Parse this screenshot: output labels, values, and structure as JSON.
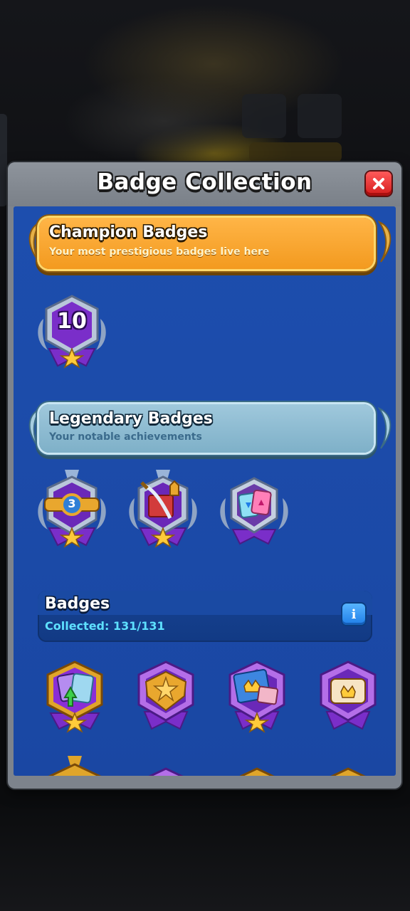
{
  "dialog": {
    "title": "Badge Collection",
    "close_icon": "close-x-icon"
  },
  "sections": {
    "champion": {
      "title": "Champion Badges",
      "subtitle": "Your most prestigious badges live here",
      "badges": [
        {
          "name": "champion-badge-10",
          "label": "10",
          "icon": "star-medal-icon"
        }
      ]
    },
    "legendary": {
      "title": "Legendary Badges",
      "subtitle": "Your notable achievements",
      "badges": [
        {
          "name": "legendary-badge-belt",
          "label": "3",
          "icon": "championship-belt-icon"
        },
        {
          "name": "legendary-badge-sword",
          "icon": "sword-crown-icon"
        },
        {
          "name": "legendary-badge-cards",
          "icon": "card-swap-icon"
        }
      ]
    },
    "badges": {
      "title": "Badges",
      "collected_text": "Collected: 131/131",
      "info_icon": "info-icon",
      "info_label": "i",
      "badges": [
        {
          "name": "badge-card-upgrade",
          "icon": "card-upgrade-icon"
        },
        {
          "name": "badge-star-shield",
          "icon": "star-shield-icon"
        },
        {
          "name": "badge-crown-cards",
          "icon": "crown-cards-icon"
        },
        {
          "name": "badge-crown-card",
          "icon": "crown-card-icon"
        }
      ]
    }
  },
  "colors": {
    "panel_blue": "#1b4aa8",
    "champion_orange": "#f39a1f",
    "legendary_blue": "#7eb0c8",
    "badge_purple": "#7a2ec9",
    "close_red": "#d41c1c",
    "collected_cyan": "#5ee0ff"
  }
}
